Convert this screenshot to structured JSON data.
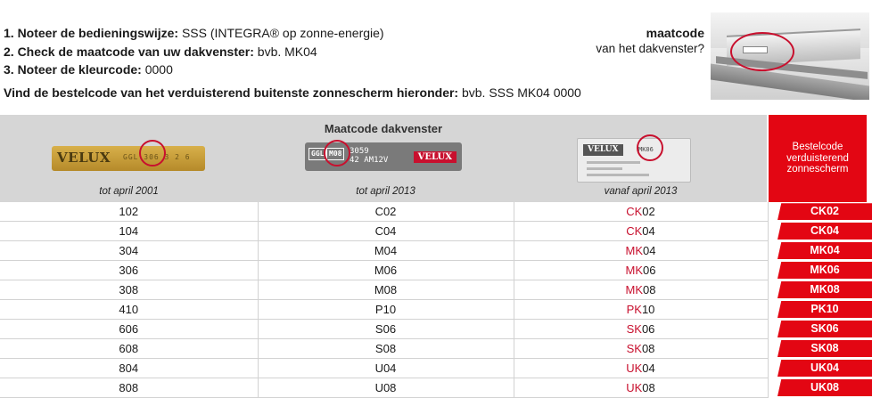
{
  "instructions": {
    "line1_label": "1. Noteer de bedieningswijze:",
    "line1_value": "SSS (INTEGRA® op zonne-energie)",
    "line2_label": "2. Check de maatcode van uw dakvenster:",
    "line2_value": "bvb. MK04",
    "line3_label": "3. Noteer de kleurcode:",
    "line3_value": "0000",
    "line4_label": "Vind de bestelcode van het verduisterend buitenste zonnescherm hieronder:",
    "line4_value": "bvb. SSS MK04 0000"
  },
  "maatcode": {
    "title": "maatcode",
    "subtitle": "van het dakvenster?"
  },
  "table": {
    "group_header": "Maatcode dakvenster",
    "col1_caption": "tot april 2001",
    "col2_caption": "tot april 2013",
    "col3_caption": "vanaf april 2013",
    "order_header": "Bestelcode verduisterend zonnescherm",
    "rows": [
      {
        "c1": "102",
        "c2": "C02",
        "c3_prefix": "CK",
        "c3_rest": "02",
        "code": "CK02"
      },
      {
        "c1": "104",
        "c2": "C04",
        "c3_prefix": "CK",
        "c3_rest": "04",
        "code": "CK04"
      },
      {
        "c1": "304",
        "c2": "M04",
        "c3_prefix": "MK",
        "c3_rest": "04",
        "code": "MK04"
      },
      {
        "c1": "306",
        "c2": "M06",
        "c3_prefix": "MK",
        "c3_rest": "06",
        "code": "MK06"
      },
      {
        "c1": "308",
        "c2": "M08",
        "c3_prefix": "MK",
        "c3_rest": "08",
        "code": "MK08"
      },
      {
        "c1": "410",
        "c2": "P10",
        "c3_prefix": "PK",
        "c3_rest": "10",
        "code": "PK10"
      },
      {
        "c1": "606",
        "c2": "S06",
        "c3_prefix": "SK",
        "c3_rest": "06",
        "code": "SK06"
      },
      {
        "c1": "608",
        "c2": "S08",
        "c3_prefix": "SK",
        "c3_rest": "08",
        "code": "SK08"
      },
      {
        "c1": "804",
        "c2": "U04",
        "c3_prefix": "UK",
        "c3_rest": "04",
        "code": "UK04"
      },
      {
        "c1": "808",
        "c2": "U08",
        "c3_prefix": "UK",
        "c3_rest": "08",
        "code": "UK08"
      }
    ]
  },
  "samples": {
    "plate1_brand": "VELUX",
    "plate1_code": "GGL 306 3 2 6",
    "plate2_type": "GGL",
    "plate2_size": "M08",
    "plate2_text": "3059\n42 AM12V",
    "plate2_brand": "VELUX",
    "plate3_brand": "VELUX",
    "plate3_size": "MK06"
  },
  "colors": {
    "accent_red": "#e30613",
    "ring_red": "#c8102e",
    "header_gray": "#d6d6d6"
  }
}
